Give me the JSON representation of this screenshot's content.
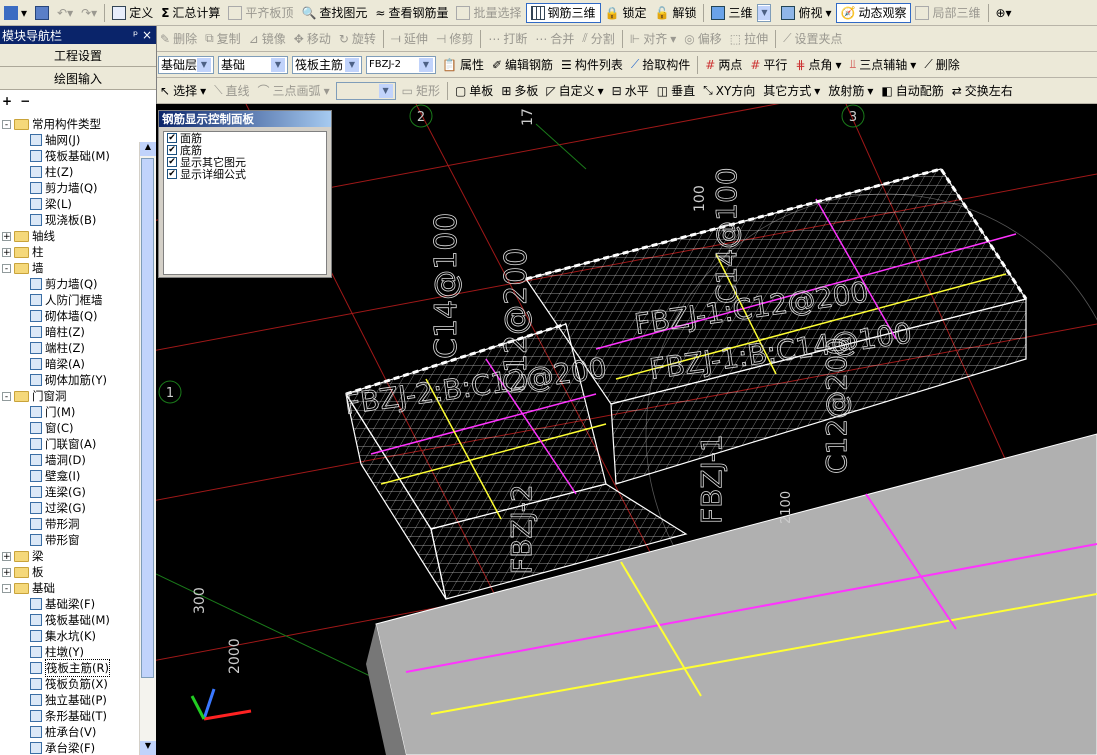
{
  "toolbar1": {
    "items": [
      "定义",
      "汇总计算",
      "平齐板顶",
      "查找图元",
      "查看钢筋量",
      "批量选择",
      "钢筋三维",
      "锁定",
      "解锁",
      "三维",
      "俯视",
      "动态观察",
      "局部三维"
    ]
  },
  "toolbar2": {
    "items": [
      "删除",
      "复制",
      "镜像",
      "移动",
      "旋转",
      "延伸",
      "修剪",
      "打断",
      "合并",
      "分割",
      "对齐",
      "偏移",
      "拉伸",
      "设置夹点"
    ]
  },
  "toolbar3": {
    "combo_floor": "基础层",
    "combo_category": "基础",
    "combo_type": "筏板主筋",
    "combo_item": "FBZJ-2",
    "items": [
      "属性",
      "编辑钢筋",
      "构件列表",
      "拾取构件",
      "两点",
      "平行",
      "点角",
      "三点辅轴",
      "删除"
    ]
  },
  "toolbar4": {
    "items": [
      "选择",
      "直线",
      "三点画弧",
      "矩形",
      "单板",
      "多板",
      "自定义",
      "水平",
      "垂直",
      "XY方向",
      "其它方式",
      "放射筋",
      "自动配筋",
      "交换左右"
    ]
  },
  "sidebar": {
    "title": "模块导航栏",
    "pin": "ᵖ ×",
    "btn_project": "工程设置",
    "btn_draw": "绘图输入",
    "tree": [
      {
        "level": 0,
        "kind": "folder",
        "exp": "-",
        "label": "常用构件类型"
      },
      {
        "level": 1,
        "kind": "cmp",
        "label": "轴网(J)"
      },
      {
        "level": 1,
        "kind": "cmp",
        "label": "筏板基础(M)"
      },
      {
        "level": 1,
        "kind": "cmp",
        "label": "柱(Z)"
      },
      {
        "level": 1,
        "kind": "cmp",
        "label": "剪力墙(Q)"
      },
      {
        "level": 1,
        "kind": "cmp",
        "label": "梁(L)"
      },
      {
        "level": 1,
        "kind": "cmp",
        "label": "现浇板(B)"
      },
      {
        "level": 0,
        "kind": "folder",
        "exp": "+",
        "label": "轴线"
      },
      {
        "level": 0,
        "kind": "folder",
        "exp": "+",
        "label": "柱"
      },
      {
        "level": 0,
        "kind": "folder",
        "exp": "-",
        "label": "墙"
      },
      {
        "level": 1,
        "kind": "cmp",
        "label": "剪力墙(Q)"
      },
      {
        "level": 1,
        "kind": "cmp",
        "label": "人防门框墙"
      },
      {
        "level": 1,
        "kind": "cmp",
        "label": "砌体墙(Q)"
      },
      {
        "level": 1,
        "kind": "cmp",
        "label": "暗柱(Z)"
      },
      {
        "level": 1,
        "kind": "cmp",
        "label": "端柱(Z)"
      },
      {
        "level": 1,
        "kind": "cmp",
        "label": "暗梁(A)"
      },
      {
        "level": 1,
        "kind": "cmp",
        "label": "砌体加筋(Y)"
      },
      {
        "level": 0,
        "kind": "folder",
        "exp": "-",
        "label": "门窗洞"
      },
      {
        "level": 1,
        "kind": "cmp",
        "label": "门(M)"
      },
      {
        "level": 1,
        "kind": "cmp",
        "label": "窗(C)"
      },
      {
        "level": 1,
        "kind": "cmp",
        "label": "门联窗(A)"
      },
      {
        "level": 1,
        "kind": "cmp",
        "label": "墙洞(D)"
      },
      {
        "level": 1,
        "kind": "cmp",
        "label": "壁龛(I)"
      },
      {
        "level": 1,
        "kind": "cmp",
        "label": "连梁(G)"
      },
      {
        "level": 1,
        "kind": "cmp",
        "label": "过梁(G)"
      },
      {
        "level": 1,
        "kind": "cmp",
        "label": "带形洞"
      },
      {
        "level": 1,
        "kind": "cmp",
        "label": "带形窗"
      },
      {
        "level": 0,
        "kind": "folder",
        "exp": "+",
        "label": "梁"
      },
      {
        "level": 0,
        "kind": "folder",
        "exp": "+",
        "label": "板"
      },
      {
        "level": 0,
        "kind": "folder",
        "exp": "-",
        "label": "基础"
      },
      {
        "level": 1,
        "kind": "cmp",
        "label": "基础梁(F)"
      },
      {
        "level": 1,
        "kind": "cmp",
        "label": "筏板基础(M)"
      },
      {
        "level": 1,
        "kind": "cmp",
        "label": "集水坑(K)"
      },
      {
        "level": 1,
        "kind": "cmp",
        "label": "柱墩(Y)"
      },
      {
        "level": 1,
        "kind": "cmp",
        "label": "筏板主筋(R)",
        "selected": true
      },
      {
        "level": 1,
        "kind": "cmp",
        "label": "筏板负筋(X)"
      },
      {
        "level": 1,
        "kind": "cmp",
        "label": "独立基础(P)"
      },
      {
        "level": 1,
        "kind": "cmp",
        "label": "条形基础(T)"
      },
      {
        "level": 1,
        "kind": "cmp",
        "label": "桩承台(V)"
      },
      {
        "level": 1,
        "kind": "cmp",
        "label": "承台梁(F)"
      }
    ]
  },
  "rebar_panel": {
    "title": "钢筋显示控制面板",
    "options": [
      {
        "label": "面筋",
        "checked": true
      },
      {
        "label": "底筋",
        "checked": true
      },
      {
        "label": "显示其它图元",
        "checked": true
      },
      {
        "label": "显示详细公式",
        "checked": true
      }
    ]
  },
  "canvas": {
    "axis_labels": [
      "2",
      "3",
      "1"
    ],
    "dim_labels": [
      "17",
      "100",
      "300",
      "2000"
    ],
    "rebar_texts": [
      "C14@100",
      "C12@200",
      "FBZJ-2:B:C12@200",
      "FBZJ-1:C12@200",
      "FBZJ-1:B:C14@100",
      "FBZJ-1",
      "FBZJ-2",
      "C14@100",
      "C12@200",
      "2100"
    ]
  },
  "colors": {
    "canvas_bg": "#000000",
    "rebar_white": "#ffffff",
    "rebar_magenta": "#ff33ff",
    "rebar_yellow": "#ffff33",
    "grid_red": "#a01818",
    "grid_green": "#1a7a1a",
    "beam_gray": "#b4b4b4"
  }
}
